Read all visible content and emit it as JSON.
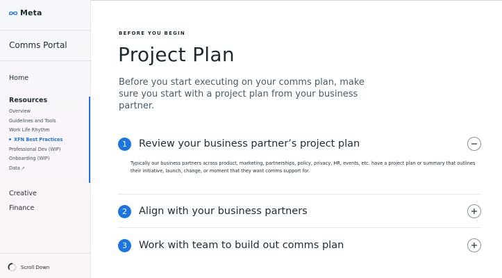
{
  "brand": {
    "logo_text": "Meta",
    "accent_color": "#1b74e4"
  },
  "sidebar": {
    "portal_title": "Comms Portal",
    "home_label": "Home",
    "resources": {
      "title": "Resources",
      "items": [
        {
          "label": "Overview"
        },
        {
          "label": "Guidelines and Tools"
        },
        {
          "label": "Work Life Rhythm"
        },
        {
          "label": "XFN Best Practices",
          "active": true
        },
        {
          "label": "Professional Dev (WIP)"
        },
        {
          "label": "Onboarding (WIP)"
        },
        {
          "label": "Data",
          "external_icon": "↗"
        }
      ]
    },
    "creative_label": "Creative",
    "finance_label": "Finance",
    "scroll_label": "Scroll Down"
  },
  "main": {
    "eyebrow": "BEFORE YOU BEGIN",
    "title": "Project Plan",
    "intro": "Before you start executing on your comms plan, make sure you start with a project plan from your business partner.",
    "steps": [
      {
        "number": "1",
        "title": "Review your business partner’s project plan",
        "expanded": true,
        "toggle_icon": "minus-icon",
        "body": "Typically our business partners across product, marketing, partnerships, policy, privacy, HR, events, etc. have a project plan or summary that outlines their initiative, launch, change, or moment that they want comms support for."
      },
      {
        "number": "2",
        "title": "Align with your business partners",
        "expanded": false,
        "toggle_icon": "plus-icon"
      },
      {
        "number": "3",
        "title": "Work with team to build out comms plan",
        "expanded": false,
        "toggle_icon": "plus-icon"
      }
    ]
  }
}
